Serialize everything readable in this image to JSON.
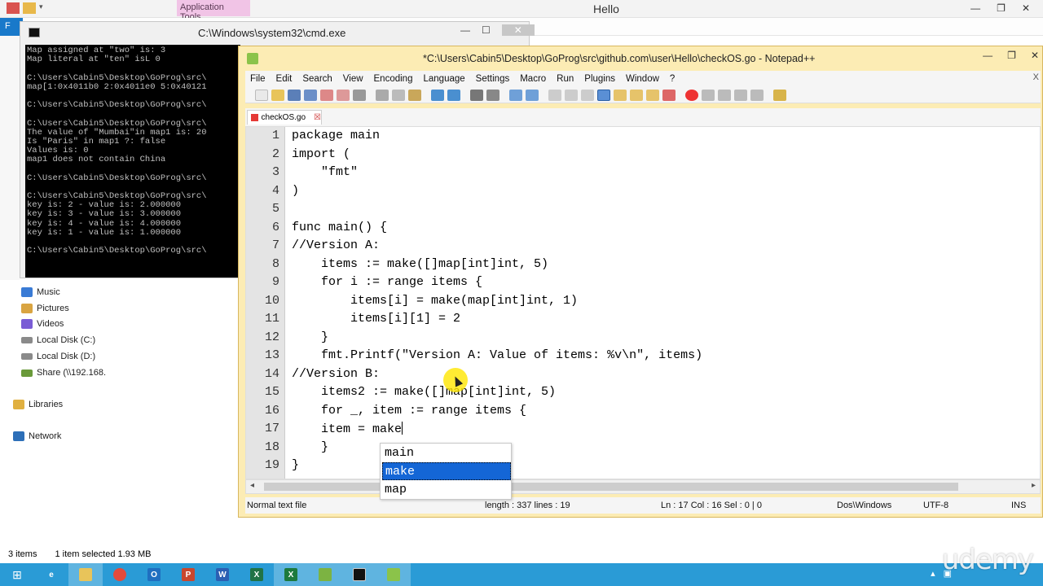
{
  "explorer": {
    "context_tab": "Application Tools",
    "title": "Hello",
    "file_tab": "F",
    "nav_items": [
      {
        "label": "Music",
        "icon": "music-icon",
        "color": "#3a7bd5"
      },
      {
        "label": "Pictures",
        "icon": "pictures-icon",
        "color": "#d9a441"
      },
      {
        "label": "Videos",
        "icon": "videos-icon",
        "color": "#7a5cd5"
      },
      {
        "label": "Local Disk (C:)",
        "icon": "drive-icon",
        "color": "#8a8a8a"
      },
      {
        "label": "Local Disk (D:)",
        "icon": "drive-icon",
        "color": "#8a8a8a"
      },
      {
        "label": "Share (\\\\192.168.",
        "icon": "network-drive-icon",
        "color": "#6a9a3a"
      },
      {
        "label": "Libraries",
        "icon": "libraries-icon",
        "color": "#e0b040"
      },
      {
        "label": "Network",
        "icon": "network-icon",
        "color": "#2d6fb8"
      }
    ],
    "status": {
      "items": "3 items",
      "selected": "1 item selected  1.93 MB"
    }
  },
  "cmd": {
    "title": "C:\\Windows\\system32\\cmd.exe",
    "lines": [
      "Map assigned at \"two\" is: 3",
      "Map literal at \"ten\" isL 0",
      "",
      "C:\\Users\\Cabin5\\Desktop\\GoProg\\src\\",
      "map[1:0x4011b0 2:0x4011e0 5:0x40121",
      "",
      "C:\\Users\\Cabin5\\Desktop\\GoProg\\src\\",
      "",
      "C:\\Users\\Cabin5\\Desktop\\GoProg\\src\\",
      "The value of \"Mumbai\"in map1 is: 20",
      "Is \"Paris\" in map1 ?: false",
      "Values is: 0",
      "map1 does not contain China",
      "",
      "C:\\Users\\Cabin5\\Desktop\\GoProg\\src\\",
      "",
      "C:\\Users\\Cabin5\\Desktop\\GoProg\\src\\",
      "key is: 2 - value is: 2.000000",
      "key is: 3 - value is: 3.000000",
      "key is: 4 - value is: 4.000000",
      "key is: 1 - value is: 1.000000",
      "",
      "C:\\Users\\Cabin5\\Desktop\\GoProg\\src\\"
    ]
  },
  "npp": {
    "title": "*C:\\Users\\Cabin5\\Desktop\\GoProg\\src\\github.com\\user\\Hello\\checkOS.go - Notepad++",
    "menu": [
      "File",
      "Edit",
      "Search",
      "View",
      "Encoding",
      "Language",
      "Settings",
      "Macro",
      "Run",
      "Plugins",
      "Window",
      "?"
    ],
    "menu_close": "X",
    "tab_label": "checkOS.go",
    "code_lines": [
      "package main",
      "import (",
      "    \"fmt\"",
      ")",
      "",
      "func main() {",
      "//Version A:",
      "    items := make([]map[int]int, 5)",
      "    for i := range items {",
      "        items[i] = make(map[int]int, 1)",
      "        items[i][1] = 2",
      "    }",
      "    fmt.Printf(\"Version A: Value of items: %v\\n\", items)",
      "//Version B:",
      "    items2 := make([]map[int]int, 5)",
      "    for _, item := range items {",
      "    item = make",
      "    }",
      "}"
    ],
    "status": {
      "type": "Normal text file",
      "length": "length : 337   lines : 19",
      "position": "Ln : 17   Col : 16   Sel : 0 | 0",
      "eol": "Dos\\Windows",
      "encoding": "UTF-8",
      "mode": "INS"
    }
  },
  "autocomplete": {
    "items": [
      "main",
      "make",
      "map"
    ],
    "selected": "make"
  },
  "watermark": "udemy"
}
